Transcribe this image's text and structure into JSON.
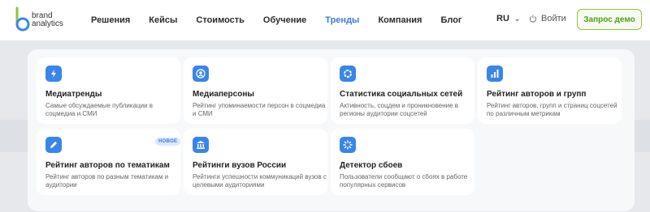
{
  "brand": {
    "line1": "brand",
    "line2": "analytics"
  },
  "nav": [
    "Решения",
    "Кейсы",
    "Стоимость",
    "Обучение",
    "Тренды",
    "Компания",
    "Блог"
  ],
  "nav_active": "Тренды",
  "header": {
    "lang": "RU",
    "login": "Войти",
    "demo": "Запрос демо"
  },
  "colors": {
    "accent": "#3a86e8",
    "brand_green": "#8cc63f",
    "active_nav": "#3a7be0"
  },
  "cards": [
    {
      "title": "Медиатренды",
      "desc": "Самые обсуждаемые публикации в соцмедиа и СМИ",
      "icon": "lightning-icon"
    },
    {
      "title": "Медиаперсоны",
      "desc": "Рейтинг упоминаемости персон в соцмедиа и СМИ",
      "icon": "person-icon"
    },
    {
      "title": "Статистика социальных сетей",
      "desc": "Активность, соцдем и проникновение в регионы аудитории соцсетей",
      "icon": "ring-icon"
    },
    {
      "title": "Рейтинг авторов и групп",
      "desc": "Рейтинг авторов, групп и страниц соцсетей по различным метрикам",
      "icon": "bar-chart-icon"
    },
    {
      "title": "Рейтинг авторов по тематикам",
      "desc": "Рейтинг авторов по разным тематикам и аудитории",
      "icon": "pencil-icon",
      "badge": "НОВОЕ"
    },
    {
      "title": "Рейтинги вузов России",
      "desc": "Рейтинги успешности коммуникаций вузов с целевыми аудиториями",
      "icon": "university-icon"
    },
    {
      "title": "Детектор сбоев",
      "desc": "Пользователи сообщают о сбоях в работе популярных сервисов",
      "icon": "loader-icon"
    }
  ]
}
